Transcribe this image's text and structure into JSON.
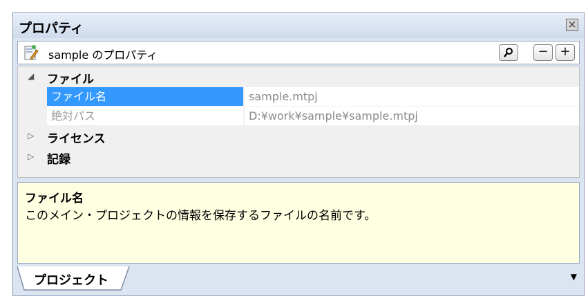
{
  "panel": {
    "title": "プロパティ",
    "close_icon": "close-icon"
  },
  "toolbar": {
    "title": "sample のプロパティ",
    "search_icon": "magnifier-icon",
    "collapse_label": "−",
    "expand_label": "+"
  },
  "tree": {
    "categories": [
      {
        "label": "ファイル",
        "expanded": true
      },
      {
        "label": "ライセンス",
        "expanded": false
      },
      {
        "label": "記録",
        "expanded": false
      }
    ],
    "properties": [
      {
        "name": "ファイル名",
        "value": "sample.mtpj",
        "selected": true
      },
      {
        "name": "絶対パス",
        "value": "D:¥work¥sample¥sample.mtpj",
        "selected": false
      }
    ]
  },
  "description": {
    "title": "ファイル名",
    "text": "このメイン・プロジェクトの情報を保存するファイルの名前です。"
  },
  "tabs": {
    "active_label": "プロジェクト"
  },
  "colors": {
    "selection": "#3399ff",
    "description_bg": "#ffffe1",
    "panel_bg": "#dbe4f1"
  }
}
